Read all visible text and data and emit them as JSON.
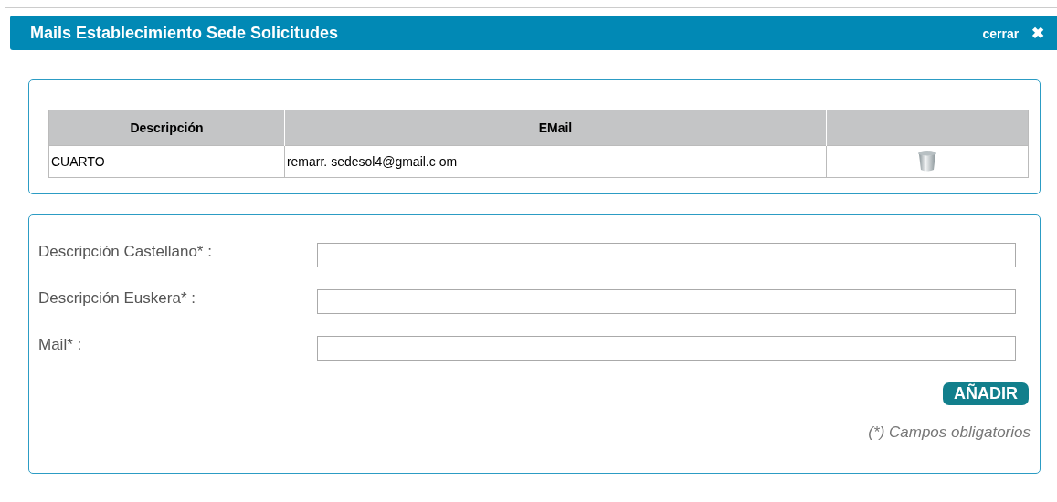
{
  "window": {
    "title": "Mails Establecimiento Sede Solicitudes",
    "close_label": "cerrar",
    "close_icon": "✖"
  },
  "table": {
    "columns": [
      "Descripción",
      "EMail"
    ],
    "rows": [
      {
        "cells": [
          "CUARTO",
          "remarr. sedesol4@gmail.c om"
        ]
      }
    ]
  },
  "form": {
    "fields": [
      {
        "label": "Descripción Castellano* :"
      },
      {
        "label": "Descripción Euskera* :"
      },
      {
        "label": "Mail* :"
      }
    ],
    "button": "AÑADIR",
    "note": "(*) Campos obligatorios"
  }
}
